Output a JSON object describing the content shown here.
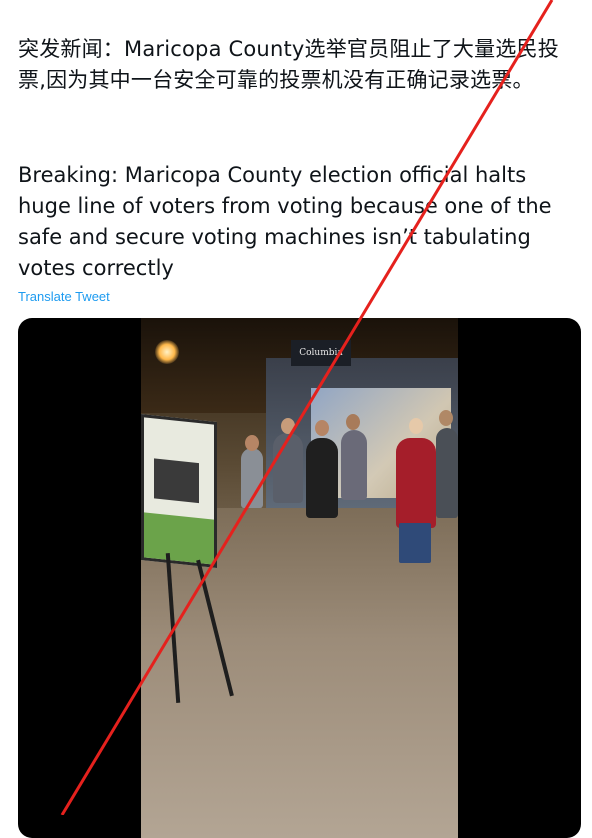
{
  "tweet": {
    "text_zh": "突发新闻：Maricopa County选举官员阻止了大量选民投票,因为其中一台安全可靠的投票机没有正确记录选票。",
    "text_en": "Breaking: Maricopa County election official halts huge line of voters from voting because one of the safe and secure voting machines isn’t tabulating votes correctly",
    "translate_label": "Translate Tweet"
  },
  "media": {
    "store_sign": "Columbia"
  },
  "colors": {
    "text": "#0f1419",
    "link": "#1d9bf0",
    "cross_line": "#e5211d"
  }
}
